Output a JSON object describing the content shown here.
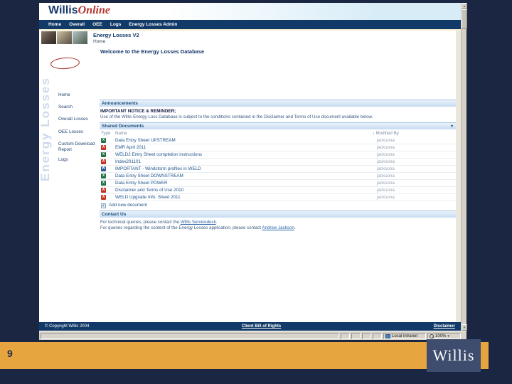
{
  "colors": {
    "slide_navy": "#1b2642",
    "gold": "#e6a53e",
    "nav_navy": "#123a68",
    "link_blue": "#2a64a8",
    "annotation_red": "#a12a25",
    "watermark_blue": "#ccdaec"
  },
  "slide": {
    "page_number": "9",
    "brand_logo": "Willis"
  },
  "app": {
    "logo": {
      "brand": "Willis",
      "product": "Online"
    },
    "nav": {
      "items": [
        "Home",
        "Overall",
        "OEE",
        "Logs",
        "Energy Losses Admin"
      ]
    },
    "header": {
      "title": "Energy Losses V2",
      "breadcrumb": "Home"
    },
    "sidebar": {
      "watermark": "Energy Losses",
      "items": [
        "Home",
        "Search",
        "Overall Losses",
        "OEE Losses",
        "Custom Download Report",
        "Logs"
      ],
      "highlighted_item": "Search"
    },
    "main": {
      "welcome": "Welcome to the Energy Losses Database",
      "announcements": {
        "title": "Announcements",
        "notice": "IMPORTANT NOTICE & REMINDER;",
        "body": "Use of the Willis Energy Loss Database is subject to the conditions contained in the Disclaimer and Terms of Use document available below."
      },
      "shared_documents": {
        "title": "Shared Documents",
        "columns": {
          "type": "Type",
          "name": "Name",
          "modified_by": "Modified By"
        },
        "rows": [
          {
            "icon": "xls",
            "name": "Data Entry Sheet UPSTREAM",
            "modified_by": "jacksona"
          },
          {
            "icon": "pdf",
            "name": "EMR April 2011",
            "modified_by": "jacksona"
          },
          {
            "icon": "xls",
            "name": "WELD2 Entry Sheet completion instructions",
            "modified_by": "jacksona"
          },
          {
            "icon": "pdf",
            "name": "Index201101",
            "modified_by": "jacksona"
          },
          {
            "icon": "doc",
            "name": "IMPORTANT - Windstorm profiles in WELD",
            "modified_by": "jacksona"
          },
          {
            "icon": "xls",
            "name": "Data Entry Sheet DOWNSTREAM",
            "modified_by": "jacksona"
          },
          {
            "icon": "xls",
            "name": "Data Entry Sheet POWER",
            "modified_by": "jacksona"
          },
          {
            "icon": "pdf",
            "name": "Disclaimer and Terms of Use 2010",
            "modified_by": "jacksona"
          },
          {
            "icon": "pdf",
            "name": "WELD Upgrade Info. Sheet 2011",
            "modified_by": "jacksona"
          }
        ],
        "add_link": "Add new document"
      },
      "contact": {
        "title": "Contact Us",
        "line1_prefix": "For technical queries, please contact the ",
        "line1_link": "Willis Servicedesk",
        "line1_suffix": ".",
        "line2_prefix": "For queries regarding the content of the Energy Losses application, please contact ",
        "line2_link": "Andrew Jackson",
        "line2_suffix": "."
      }
    },
    "footer": {
      "copyright": "© Copyright Willis 2004",
      "center_link": "Client Bill of Rights",
      "right_link": "Disclaimer"
    },
    "statusbar": {
      "zone": "Local intranet",
      "zoom": "100%"
    }
  },
  "icons": {
    "dropdown": "▾",
    "sort": "↓",
    "add": "+",
    "scroll_up": "▲",
    "scroll_down": "▼",
    "zoom_dropdown": "▾"
  }
}
